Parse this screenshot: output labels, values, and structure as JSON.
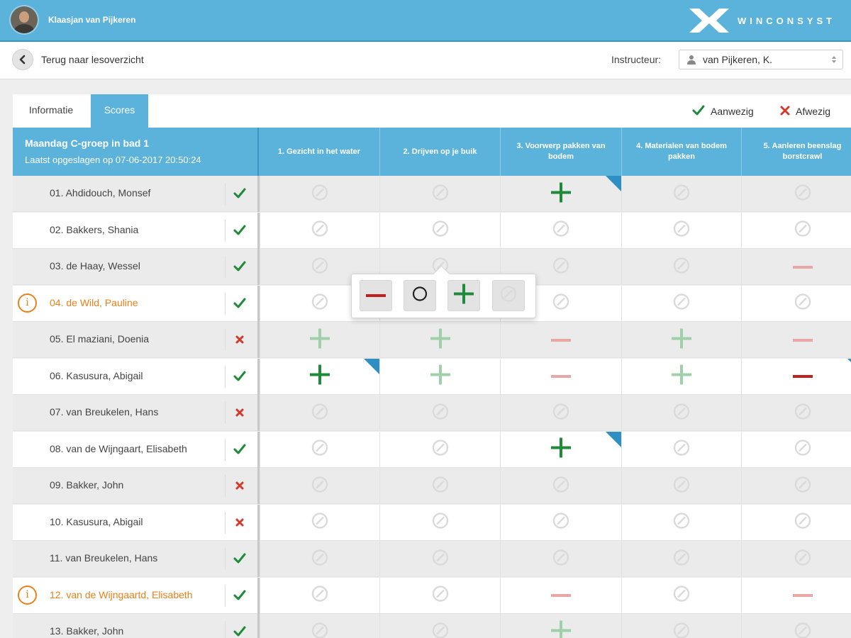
{
  "header": {
    "user_name": "Klaasjan van Pijkeren",
    "brand": "WINCONSYST"
  },
  "subbar": {
    "back_label": "Terug naar lesoverzicht",
    "instructor_label": "Instructeur:",
    "instructor_value": "van Pijkeren, K."
  },
  "tabs": [
    {
      "label": "Informatie",
      "active": false
    },
    {
      "label": "Scores",
      "active": true
    }
  ],
  "legend": {
    "present": "Aanwezig",
    "absent": "Afwezig"
  },
  "group": {
    "title": "Maandag C-groep in bad 1",
    "saved": "Laatst opgeslagen op 07-06-2017 20:50:24"
  },
  "columns": [
    "1. Gezicht in het water",
    "2. Drijven op je buik",
    "3. Voorwerp pakken van bodem",
    "4. Materialen van bodem pakken",
    "5. Aanleren beenslag borstcrawl"
  ],
  "students": [
    {
      "name": "01.  Ahdidouch, Monsef",
      "present": true,
      "alert": false,
      "scores": [
        "none",
        "none",
        "plus",
        "none",
        "none"
      ],
      "flags": [
        false,
        false,
        true,
        false,
        false
      ]
    },
    {
      "name": "02.  Bakkers, Shania",
      "present": true,
      "alert": false,
      "scores": [
        "none",
        "none",
        "none",
        "none",
        "none"
      ],
      "flags": [
        false,
        false,
        false,
        false,
        false
      ]
    },
    {
      "name": "03.  de Haay, Wessel",
      "present": true,
      "alert": false,
      "scores": [
        "none",
        "none",
        "none",
        "none",
        "minus-light"
      ],
      "flags": [
        false,
        false,
        false,
        false,
        false
      ]
    },
    {
      "name": "04.  de Wild, Pauline",
      "present": true,
      "alert": true,
      "scores": [
        "none",
        "none",
        "none",
        "none",
        "none"
      ],
      "flags": [
        false,
        false,
        false,
        false,
        false
      ]
    },
    {
      "name": "05.  El maziani, Doenia",
      "present": false,
      "alert": false,
      "scores": [
        "plus-light",
        "plus-light",
        "minus-light",
        "plus-light",
        "minus-light"
      ],
      "flags": [
        false,
        false,
        false,
        false,
        false
      ]
    },
    {
      "name": "06.  Kasusura, Abigail",
      "present": true,
      "alert": false,
      "scores": [
        "plus",
        "plus-light",
        "minus-light",
        "plus-light",
        "minus"
      ],
      "flags": [
        true,
        false,
        false,
        false,
        true
      ]
    },
    {
      "name": "07.  van Breukelen, Hans",
      "present": false,
      "alert": false,
      "scores": [
        "none",
        "none",
        "none",
        "none",
        "none"
      ],
      "flags": [
        false,
        false,
        false,
        false,
        false
      ]
    },
    {
      "name": "08.  van de Wijngaart, Elisabeth",
      "present": true,
      "alert": false,
      "scores": [
        "none",
        "none",
        "plus",
        "none",
        "none"
      ],
      "flags": [
        false,
        false,
        true,
        false,
        false
      ]
    },
    {
      "name": "09.  Bakker, John",
      "present": false,
      "alert": false,
      "scores": [
        "none",
        "none",
        "none",
        "none",
        "none"
      ],
      "flags": [
        false,
        false,
        false,
        false,
        false
      ]
    },
    {
      "name": "10.  Kasusura, Abigail",
      "present": false,
      "alert": false,
      "scores": [
        "none",
        "none",
        "none",
        "none",
        "none"
      ],
      "flags": [
        false,
        false,
        false,
        false,
        false
      ]
    },
    {
      "name": "11.  van Breukelen, Hans",
      "present": true,
      "alert": false,
      "scores": [
        "none",
        "none",
        "none",
        "none",
        "none"
      ],
      "flags": [
        false,
        false,
        false,
        false,
        false
      ]
    },
    {
      "name": "12.  van de Wijngaartd, Elisabeth",
      "present": true,
      "alert": true,
      "scores": [
        "none",
        "none",
        "minus-light",
        "none",
        "minus-light"
      ],
      "flags": [
        false,
        false,
        false,
        false,
        false
      ]
    },
    {
      "name": "13.  Bakker, John",
      "present": true,
      "alert": false,
      "scores": [
        "none",
        "none",
        "plus-light",
        "none",
        "none"
      ],
      "flags": [
        false,
        false,
        false,
        false,
        false
      ]
    }
  ],
  "popup": {
    "options": [
      "minus",
      "circle",
      "plus",
      "none"
    ]
  },
  "colors": {
    "accent": "#5bb3dc",
    "present": "#1f8a3a",
    "absent": "#d33a2c",
    "plus": "#1f8a3a",
    "minus": "#c0201f",
    "alert": "#e8811a"
  }
}
